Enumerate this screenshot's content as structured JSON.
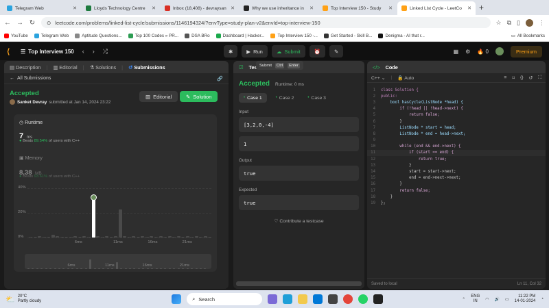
{
  "browser": {
    "tabs": [
      {
        "title": "Telegram Web",
        "color": "#2aa3de",
        "active": false
      },
      {
        "title": "Lloyds Technology Centre",
        "color": "#1e7b3f",
        "active": false
      },
      {
        "title": "Inbox (18,408) - devraysan",
        "color": "#d93025",
        "active": false
      },
      {
        "title": "Why we use inheritance in",
        "color": "#222222",
        "active": false
      },
      {
        "title": "Top Interview 150 - Study",
        "color": "#ffa116",
        "active": false
      },
      {
        "title": "Linked List Cycle - LeetCo",
        "color": "#ffa116",
        "active": true
      }
    ],
    "url": "leetcode.com/problems/linked-list-cycle/submissions/1146194324/?envType=study-plan-v2&envId=top-interview-150",
    "bookmarks": [
      {
        "label": "YouTube",
        "color": "#ff0000"
      },
      {
        "label": "Telegram Web",
        "color": "#2aa3de"
      },
      {
        "label": "Aptitude Questions...",
        "color": "#888888"
      },
      {
        "label": "Top 100 Codes » PR...",
        "color": "#2c9c52"
      },
      {
        "label": "DSA BRo",
        "color": "#555555"
      },
      {
        "label": "Dashboard | Hacker...",
        "color": "#1ba94c"
      },
      {
        "label": "Top Interview 150 -...",
        "color": "#ffa116"
      },
      {
        "label": "Get Started - Skill B...",
        "color": "#333333"
      },
      {
        "label": "Denigma - AI that r...",
        "color": "#111111"
      }
    ],
    "all_bookmarks": "All Bookmarks"
  },
  "lcnav": {
    "title": "Top Interview 150",
    "run": "Run",
    "submit": "Submit",
    "streak": "0",
    "premium": "Premium",
    "tooltip": {
      "label": "Submit",
      "key1": "Ctrl",
      "key2": "Enter"
    }
  },
  "left": {
    "tabs": {
      "description": "Description",
      "editorial": "Editorial",
      "solutions": "Solutions",
      "submissions": "Submissions"
    },
    "all_submissions": "All Submissions",
    "status": "Accepted",
    "author": "Sanket Devray",
    "submitted_text": "submitted at Jan 14, 2024 23:22",
    "editorial_btn": "Editorial",
    "solution_btn": "Solution",
    "runtime_label": "Runtime",
    "runtime_value": "7",
    "runtime_unit": "ms",
    "beats_prefix": "Beats",
    "runtime_beats": "89.54%",
    "beats_suffix": "of users with C++",
    "memory_label": "Memory",
    "memory_value": "8.38",
    "memory_unit": "MB",
    "memory_beats": "93.61%"
  },
  "chart_data": {
    "type": "bar",
    "ytick_labels": [
      "40%",
      "20%",
      "0%"
    ],
    "ylim": [
      0,
      40
    ],
    "xtick_labels": [
      "6ms",
      "11ms",
      "16ms",
      "21ms"
    ],
    "values": [
      0.5,
      0.5,
      1,
      0.5,
      0.5,
      2,
      1,
      0.5,
      0.5,
      0.5,
      1,
      0.5,
      1,
      0.5,
      32,
      1,
      0.5,
      1,
      0.5,
      1,
      23,
      1,
      0.5,
      1,
      0.5,
      1,
      0.5,
      1,
      0.5,
      1,
      0.5,
      1,
      0.5,
      1,
      0.5,
      1,
      0.5,
      1,
      0.5,
      1,
      0.5
    ],
    "highlight_index": 14,
    "mini_xtick_labels": [
      "6ms",
      "11ms",
      "16ms",
      "21ms"
    ]
  },
  "mid": {
    "tab": "Testcase",
    "status": "Accepted",
    "runtime": "Runtime: 0 ms",
    "cases": [
      "Case 1",
      "Case 2",
      "Case 3"
    ],
    "input_label": "Input",
    "input1": "[3,2,0,-4]",
    "input2": "1",
    "output_label": "Output",
    "output": "true",
    "expected_label": "Expected",
    "expected": "true",
    "contribute": "Contribute a testcase"
  },
  "right": {
    "tab": "Code",
    "lang": "C++",
    "mode": "Auto",
    "saved": "Saved to local",
    "cursor": "Ln 11, Col 32",
    "code": [
      "class Solution {",
      "public:",
      "    bool hasCycle(ListNode *head) {",
      "        if (!head || !head->next) {",
      "            return false;",
      "        }",
      "        ListNode * start = head;",
      "        ListNode * end = head->next;",
      "",
      "        while (end && end->next) {",
      "            if (start == end) {",
      "                return true;",
      "            }",
      "            start = start->next;",
      "            end = end->next->next;",
      "        }",
      "        return false;",
      "    }",
      "};"
    ]
  },
  "taskbar": {
    "weather_temp": "20°C",
    "weather_desc": "Partly cloudy",
    "search": "Search",
    "lang": "ENG",
    "region": "IN",
    "time": "11:22 PM",
    "date": "14-01-2024"
  }
}
